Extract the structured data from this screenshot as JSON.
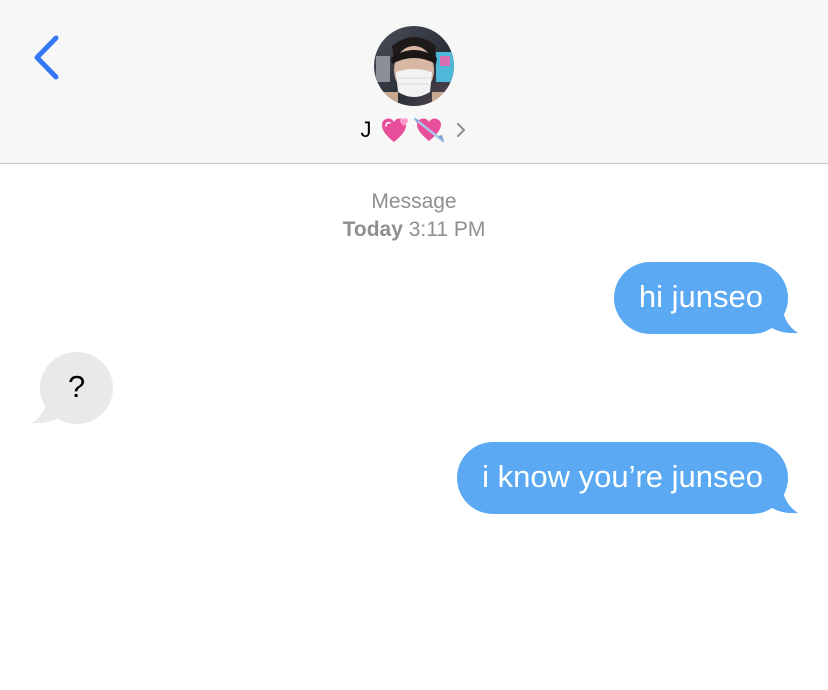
{
  "nav": {
    "back_icon": "chevron-left-icon",
    "accent_color": "#3478f6"
  },
  "contact": {
    "name": "J",
    "emojis": [
      "💞",
      "💘"
    ],
    "chevron_icon": "chevron-right-icon"
  },
  "thread": {
    "service": "Message",
    "day": "Today",
    "time": "3:11 PM"
  },
  "messages": [
    {
      "direction": "outgoing",
      "text": "hi junseo"
    },
    {
      "direction": "incoming",
      "text": "?"
    },
    {
      "direction": "outgoing",
      "text": "i know you’re junseo"
    }
  ],
  "colors": {
    "outgoing_bubble": "#5aa9f2",
    "incoming_bubble": "#e9e9eb",
    "header_bg": "#f7f7f7",
    "meta_text": "#8e8e93"
  }
}
